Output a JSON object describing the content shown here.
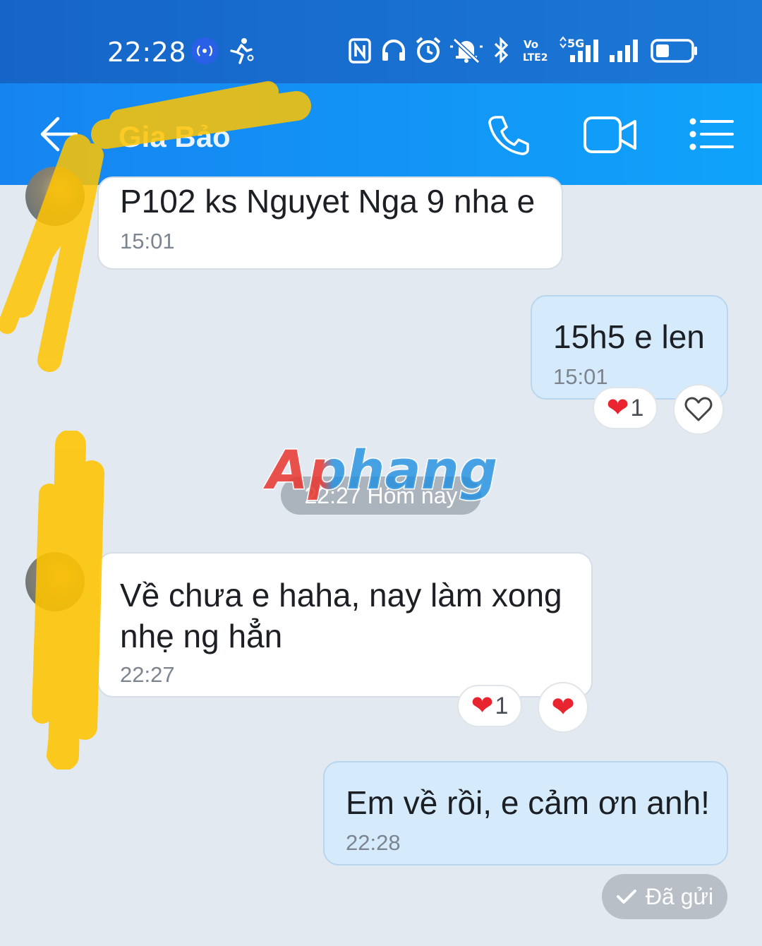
{
  "status_bar": {
    "time": "22:28",
    "icons": [
      "hotspot-icon",
      "running-icon",
      "nfc-icon",
      "headphones-icon",
      "alarm-icon",
      "mute-icon",
      "bluetooth-icon",
      "volte-icon",
      "signal-5g-icon",
      "signal-icon",
      "battery-icon"
    ],
    "volte_label": "Vo\nLTE2",
    "network_label": "5G"
  },
  "header": {
    "contact_name": "Gia Bảo",
    "back_icon": "back-arrow-icon",
    "call_icon": "phone-icon",
    "video_icon": "video-camera-icon",
    "menu_icon": "menu-list-icon"
  },
  "messages": [
    {
      "direction": "in",
      "text": "P102 ks Nguyet Nga 9 nha e",
      "time": "15:01"
    },
    {
      "direction": "out",
      "text": "15h5 e len",
      "time": "15:01",
      "reaction_count": "1"
    },
    {
      "direction": "in",
      "text": "Về chưa e haha, nay làm xong nhẹ ng hẳn",
      "time": "22:27",
      "reaction_count": "1"
    },
    {
      "direction": "out",
      "text": "Em về rồi, e cảm ơn anh!",
      "time": "22:28"
    }
  ],
  "date_divider": "22:27 Hôm nay",
  "watermark": "Aphang",
  "sent_status": "Đã gửi",
  "colors": {
    "status_bar": "#1565c8",
    "header_start": "#1684f0",
    "header_end": "#0fa3fb",
    "chat_bg": "#e2e9f1",
    "outgoing_bubble": "#d5ebfb",
    "incoming_bubble": "#ffffff",
    "heart": "#e8242f",
    "scribble": "#ffc400"
  }
}
